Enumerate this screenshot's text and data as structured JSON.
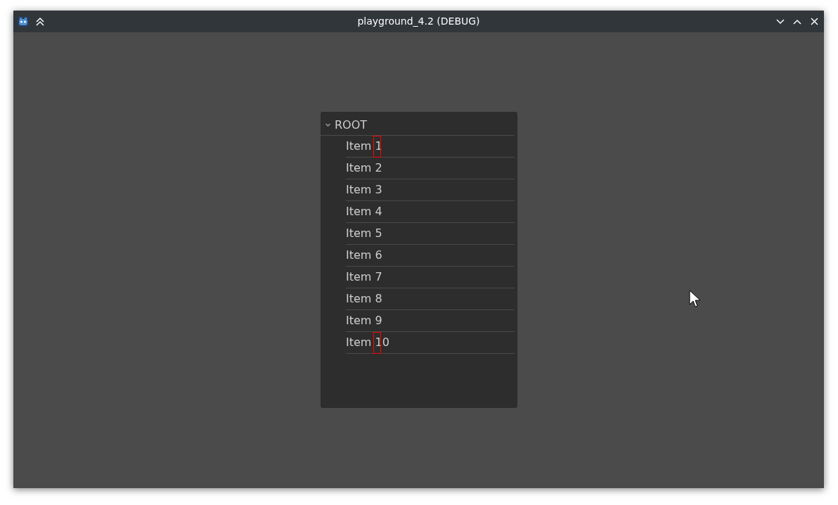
{
  "window": {
    "title": "playground_4.2 (DEBUG)"
  },
  "tree": {
    "label": "ROOT",
    "expanded": true,
    "children": [
      {
        "label": "Item 1",
        "marked": true
      },
      {
        "label": "Item 2",
        "marked": false
      },
      {
        "label": "Item 3",
        "marked": false
      },
      {
        "label": "Item 4",
        "marked": false
      },
      {
        "label": "Item 5",
        "marked": false
      },
      {
        "label": "Item 6",
        "marked": false
      },
      {
        "label": "Item 7",
        "marked": false
      },
      {
        "label": "Item 8",
        "marked": false
      },
      {
        "label": "Item 9",
        "marked": false
      },
      {
        "label": "Item 10",
        "marked": true
      }
    ]
  }
}
